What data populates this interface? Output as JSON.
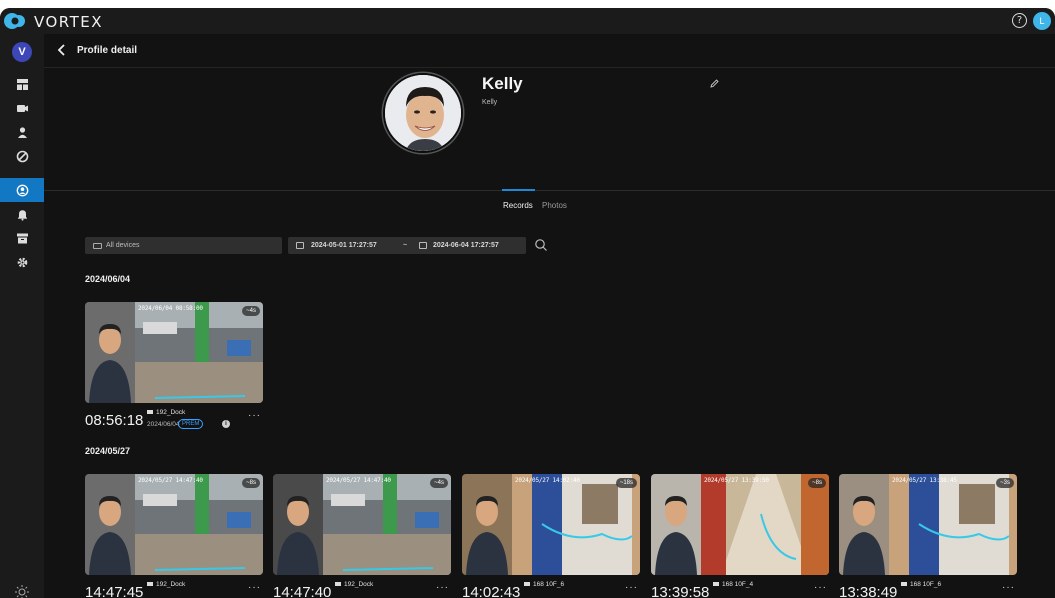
{
  "app": {
    "brand": "VORTEX",
    "user_initial": "L",
    "workspace_initial": "V",
    "accent_color": "#1278c4"
  },
  "header": {
    "title": "Profile detail"
  },
  "profile": {
    "name": "Kelly",
    "subtitle": "Kelly"
  },
  "tabs": [
    {
      "label": "Records",
      "active": true
    },
    {
      "label": "Photos",
      "active": false
    }
  ],
  "filters": {
    "device_placeholder": "All devices",
    "start": "2024-05-01  17:27:57",
    "separator": "~",
    "end": "2024-06-04  17:27:57"
  },
  "sidebar": {
    "items": [
      {
        "icon": "dashboard-icon",
        "active": false
      },
      {
        "icon": "camera-icon",
        "active": false
      },
      {
        "icon": "person-icon",
        "active": false
      },
      {
        "icon": "tag-icon",
        "active": false
      },
      {
        "icon": "face-profile-icon",
        "active": true
      },
      {
        "icon": "bell-icon",
        "active": false
      },
      {
        "icon": "archive-icon",
        "active": false
      },
      {
        "icon": "gear-icon",
        "active": false
      }
    ]
  },
  "groups": [
    {
      "date": "2024/06/04",
      "records": [
        {
          "time": "08:56:18",
          "camera": "192_Dock",
          "date": "2024/06/04",
          "badge": "PREM",
          "stamp": "2024/06/04 08:58:00",
          "duration": "4s",
          "scene": "street"
        }
      ]
    },
    {
      "date": "2024/05/27",
      "records": [
        {
          "time": "14:47:45",
          "camera": "192_Dock",
          "stamp": "2024/05/27 14:47:40",
          "duration": "8s",
          "scene": "street"
        },
        {
          "time": "14:47:40",
          "camera": "192_Dock",
          "stamp": "2024/05/27 14:47:40",
          "duration": "4s",
          "scene": "street"
        },
        {
          "time": "14:02:43",
          "camera": "168 10F_6",
          "stamp": "2024/05/27 14:02:40",
          "duration": "18s",
          "scene": "hall"
        },
        {
          "time": "13:39:58",
          "camera": "168 10F_4",
          "stamp": "2024/05/27 13:39:50",
          "duration": "8s",
          "scene": "corridor"
        },
        {
          "time": "13:38:49",
          "camera": "168 10F_6",
          "stamp": "2024/05/27 13:38:45",
          "duration": "3s",
          "scene": "hall"
        }
      ]
    }
  ]
}
